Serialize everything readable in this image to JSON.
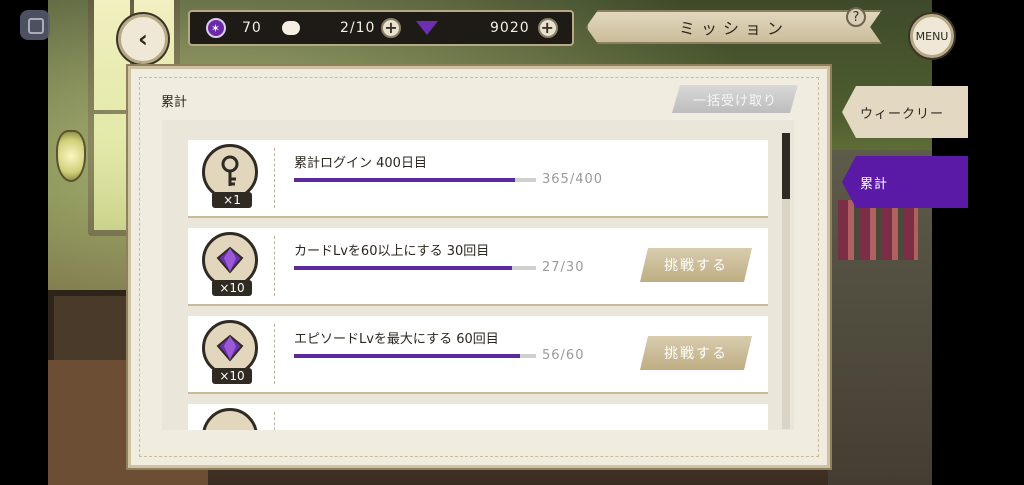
{
  "header": {
    "stat1_value": "70",
    "stat2_value": "2/10",
    "stat3_value": "9020",
    "mission_title": "ミッション",
    "help_label": "?",
    "menu_label": "MENU"
  },
  "panel": {
    "title": "累計",
    "claim_all_label": "一括受け取り"
  },
  "missions": [
    {
      "qty": "×1",
      "text": "累計ログイン 400日目",
      "progress": "365/400",
      "ratio": 0.9125,
      "button": "",
      "icon": "key-icon"
    },
    {
      "qty": "×10",
      "text": "カードLvを60以上にする 30回目",
      "progress": "27/30",
      "ratio": 0.9,
      "button": "挑戦する",
      "icon": "crystal-icon"
    },
    {
      "qty": "×10",
      "text": "エピソードLvを最大にする 60回目",
      "progress": "56/60",
      "ratio": 0.933,
      "button": "挑戦する",
      "icon": "crystal-icon"
    }
  ],
  "tabs": {
    "weekly": "ウィークリー",
    "cumulative": "累計"
  },
  "colors": {
    "accent_purple": "#5b1aa6",
    "progress_fill": "#5a2a9e",
    "panel_bg": "#f1ece0"
  }
}
